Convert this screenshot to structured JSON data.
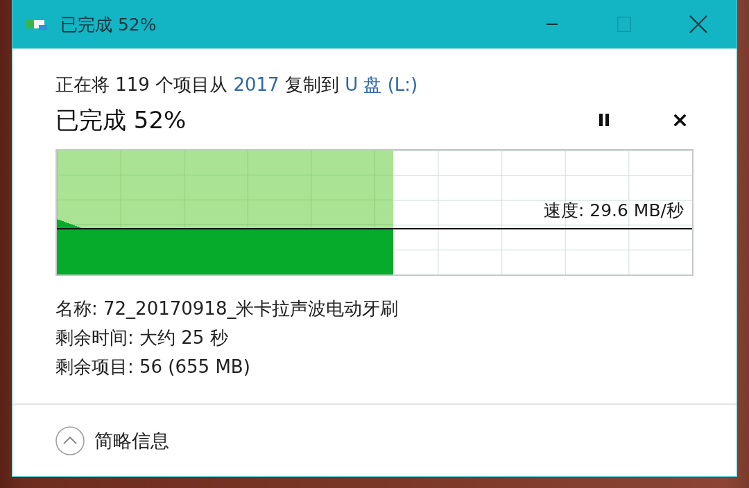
{
  "window": {
    "title": "已完成 52%",
    "controls": [
      {
        "kind": "minimize",
        "disabled": false
      },
      {
        "kind": "maximize",
        "disabled": true
      },
      {
        "kind": "close",
        "disabled": false
      }
    ]
  },
  "operation": {
    "parts": [
      {
        "kind": "text",
        "text": "正在将 119 个项目从"
      },
      {
        "kind": "link",
        "text": "2017"
      },
      {
        "kind": "text",
        "text": "复制到"
      },
      {
        "kind": "link",
        "text": "U 盘 (L:)"
      }
    ]
  },
  "status": {
    "title": "已完成 52%",
    "actions": [
      {
        "kind": "pause"
      },
      {
        "kind": "cancel"
      }
    ]
  },
  "graph": {
    "level": 0.53,
    "speed": "速度: 29.6 MB/秒"
  },
  "details": [
    "名称: 72_20170918_米卡拉声波电动牙刷",
    "剩余时间: 大约 25 秒",
    "剩余项目: 56 (655 MB)"
  ],
  "footer": {
    "label": "简略信息",
    "expanded": true
  }
}
